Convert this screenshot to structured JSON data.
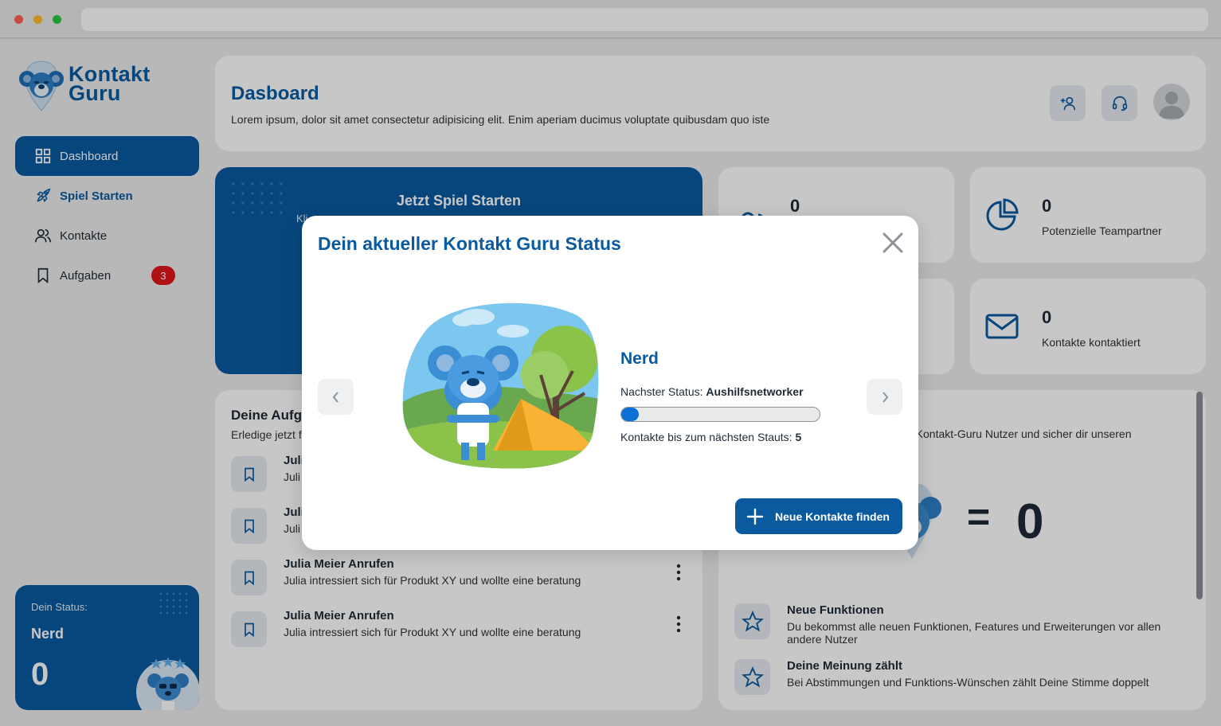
{
  "brand": {
    "line1": "Kontakt",
    "line2": "Guru"
  },
  "sidebar": {
    "items": [
      {
        "label": "Dashboard",
        "icon": "grid-icon"
      },
      {
        "label": "Spiel Starten",
        "icon": "rocket-icon"
      },
      {
        "label": "Kontakte",
        "icon": "users-icon"
      },
      {
        "label": "Aufgaben",
        "icon": "bookmark-icon",
        "badge": "3"
      }
    ],
    "status": {
      "label": "Dein Status:",
      "rank": "Nerd",
      "value": "0"
    }
  },
  "header": {
    "title": "Dasboard",
    "subtitle": "Lorem ipsum, dolor sit amet consectetur adipisicing elit. Enim aperiam ducimus voluptate quibusdam quo iste"
  },
  "game": {
    "title": "Jetzt Spiel Starten",
    "subtitle": "Kli"
  },
  "stats": [
    {
      "value": "0",
      "label": "",
      "icon": "contacts-icon"
    },
    {
      "value": "0",
      "label": "Potenzielle Teampartner",
      "icon": "pie-chart-icon"
    },
    {
      "value": "",
      "label": "",
      "icon": ""
    },
    {
      "value": "0",
      "label": "Kontakte kontaktiert",
      "icon": "mail-icon"
    }
  ],
  "tasks": {
    "title": "Deine Aufg",
    "subtitle": "Erledige jetzt f",
    "items": [
      {
        "title": "Juli",
        "desc": "Juli"
      },
      {
        "title": "Juli",
        "desc": "Juli"
      },
      {
        "title": "Julia Meier Anrufen",
        "desc": "Julia intressiert sich für Produkt XY und wollte eine beratung"
      },
      {
        "title": "Julia Meier Anrufen",
        "desc": "Julia intressiert sich für Produkt XY und wollte eine beratung"
      }
    ]
  },
  "premium": {
    "subtitle": "e Kontakt-Guru Nutzer und sicher dir unseren",
    "equals": "=",
    "value": "0",
    "features": [
      {
        "title": "Neue Funktionen",
        "desc": "Du bekommst alle neuen Funktionen, Features und Erweiterungen vor allen andere Nutzer"
      },
      {
        "title": "Deine Meinung zählt",
        "desc": "Bei Abstimmungen und Funktions-Wünschen zählt Deine Stimme doppelt"
      }
    ]
  },
  "modal": {
    "title": "Dein aktueller Kontakt Guru Status",
    "rank": "Nerd",
    "next_label": "Nachster Status: ",
    "next_value": "Aushilfsnetworker",
    "progress": 0.09,
    "contacts_label": "Kontakte bis zum nächsten Stauts: ",
    "contacts_value": "5",
    "cta": "Neue Kontakte finden"
  },
  "colors": {
    "brand": "#0a5aa0",
    "badge": "#e0161b",
    "progress": "#0a6fd6"
  }
}
